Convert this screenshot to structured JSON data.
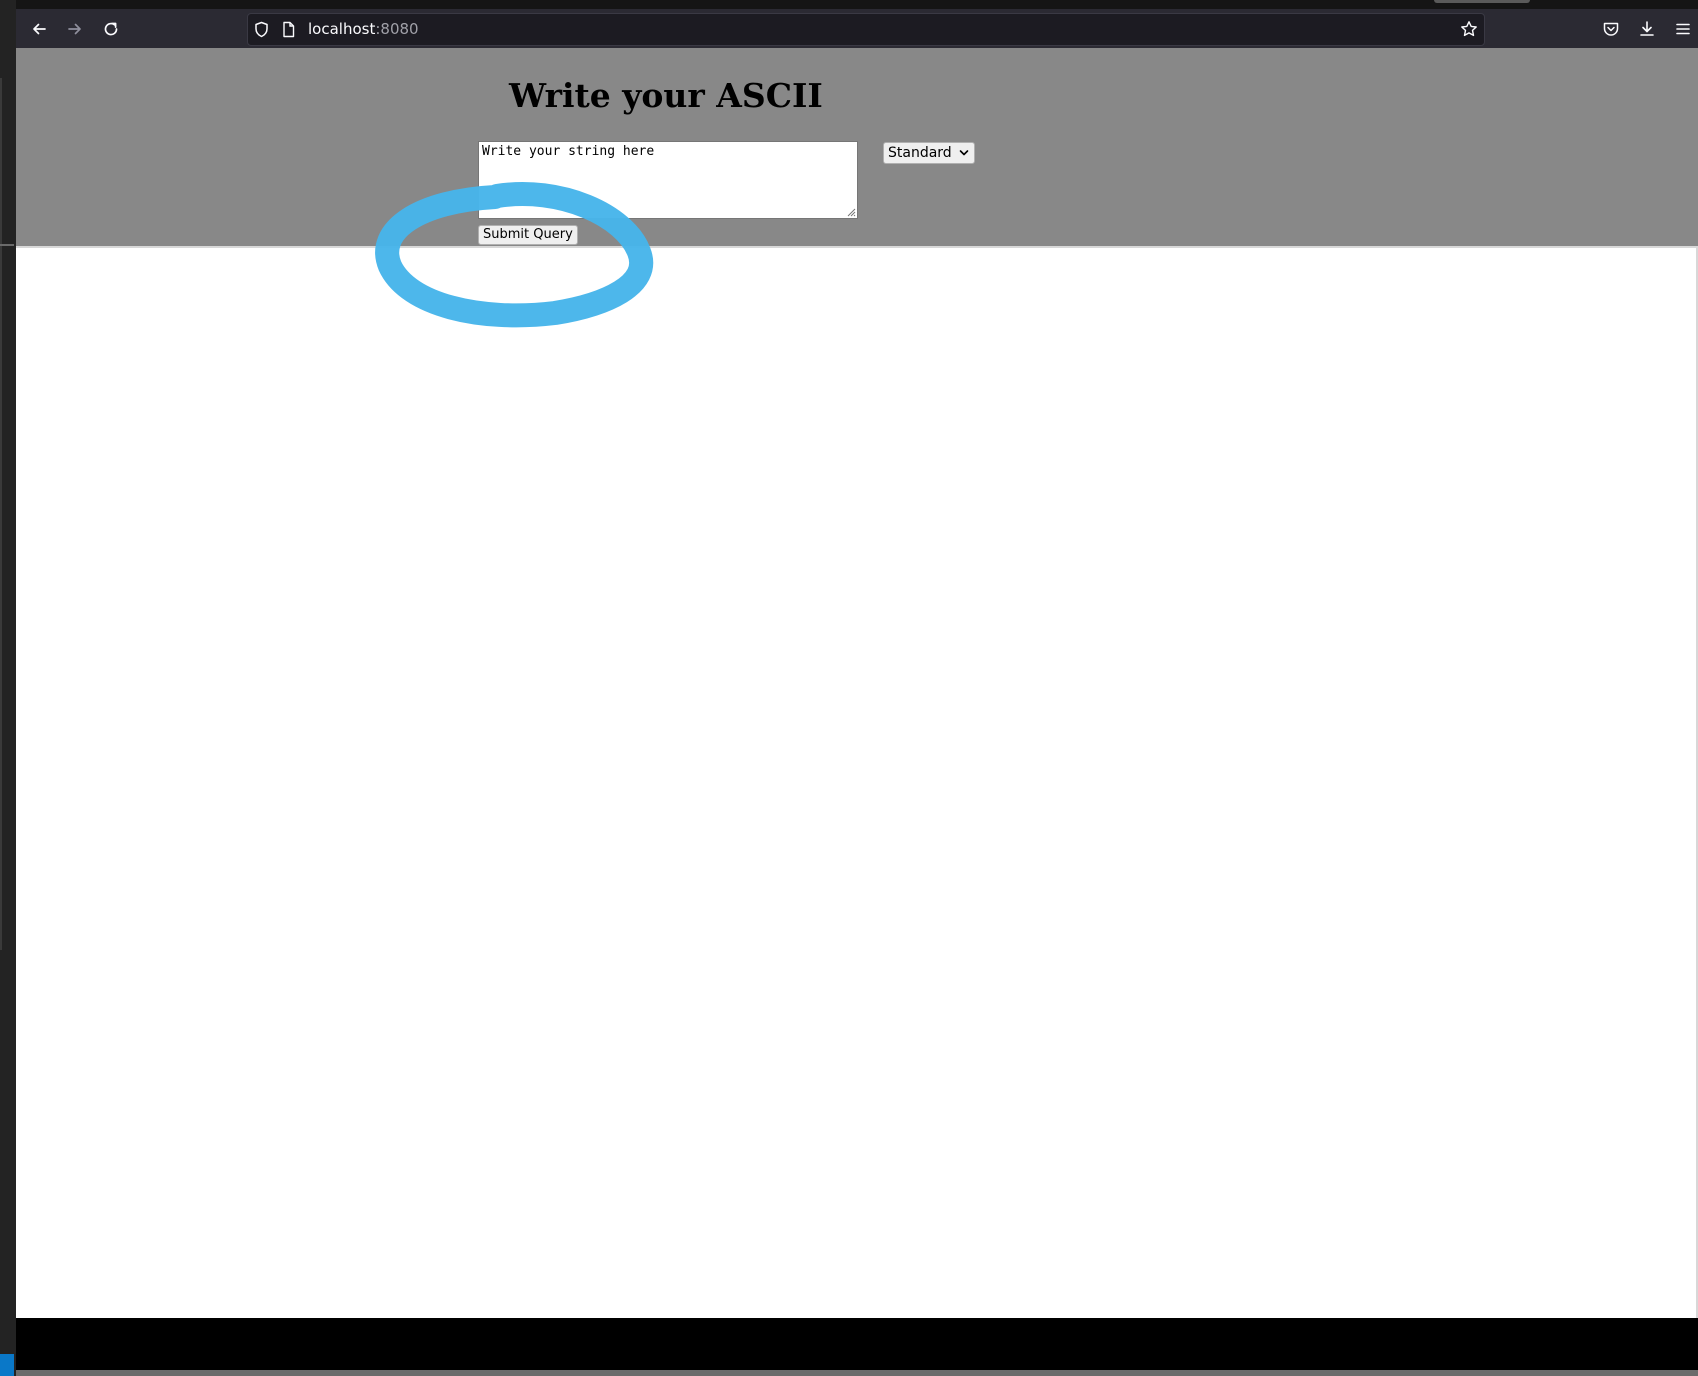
{
  "browser": {
    "url_host": "localhost",
    "url_port": ":8080",
    "icons": [
      "back-arrow-icon",
      "forward-arrow-icon",
      "reload-icon",
      "shield-icon",
      "page-icon",
      "bookmark-star-icon",
      "pocket-icon",
      "download-icon",
      "menu-icon"
    ]
  },
  "page": {
    "title": "Write your ASCII",
    "textarea_value": "Write your string here",
    "select_value": "Standard",
    "submit_label": "Submit Query",
    "colors": {
      "header_band": "#888888",
      "annotation_stroke": "#47b5ea"
    }
  }
}
